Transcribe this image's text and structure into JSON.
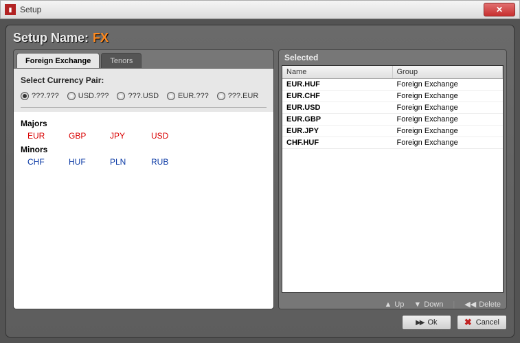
{
  "window": {
    "title": "Setup"
  },
  "header": {
    "label": "Setup Name:",
    "value": "FX"
  },
  "tabs": {
    "foreign_exchange": "Foreign Exchange",
    "tenors": "Tenors"
  },
  "filter": {
    "title": "Select Currency Pair:",
    "options": [
      {
        "label": "???.???",
        "selected": true
      },
      {
        "label": "USD.???",
        "selected": false
      },
      {
        "label": "???.USD",
        "selected": false
      },
      {
        "label": "EUR.???",
        "selected": false
      },
      {
        "label": "???.EUR",
        "selected": false
      }
    ]
  },
  "groups": {
    "majors": {
      "title": "Majors",
      "items": [
        "EUR",
        "GBP",
        "JPY",
        "USD"
      ]
    },
    "minors": {
      "title": "Minors",
      "items": [
        "CHF",
        "HUF",
        "PLN",
        "RUB"
      ]
    }
  },
  "selected_panel": {
    "title": "Selected",
    "cols": {
      "name": "Name",
      "group": "Group"
    },
    "rows": [
      {
        "name": "EUR.HUF",
        "group": "Foreign Exchange"
      },
      {
        "name": "EUR.CHF",
        "group": "Foreign Exchange"
      },
      {
        "name": "EUR.USD",
        "group": "Foreign Exchange"
      },
      {
        "name": "EUR.GBP",
        "group": "Foreign Exchange"
      },
      {
        "name": "EUR.JPY",
        "group": "Foreign Exchange"
      },
      {
        "name": "CHF.HUF",
        "group": "Foreign Exchange"
      }
    ]
  },
  "tools": {
    "up": "Up",
    "down": "Down",
    "delete": "Delete"
  },
  "footer": {
    "ok": "Ok",
    "cancel": "Cancel"
  }
}
